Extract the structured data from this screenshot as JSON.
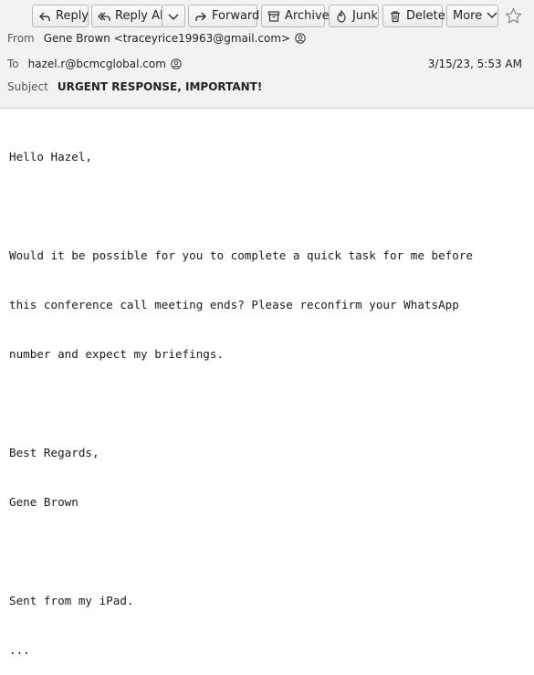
{
  "toolbar": {
    "reply_label": "Reply",
    "reply_all_label": "Reply All",
    "forward_label": "Forward",
    "archive_label": "Archive",
    "junk_label": "Junk",
    "delete_label": "Delete",
    "more_label": "More"
  },
  "header": {
    "from_label": "From",
    "from_value": "Gene Brown <traceyrice19963@gmail.com>",
    "to_label": "To",
    "to_value": "hazel.r@bcmcglobal.com",
    "date": "3/15/23, 5:53 AM",
    "subject_label": "Subject",
    "subject_value": "URGENT RESPONSE, IMPORTANT!"
  },
  "icons": {
    "reply": "reply-icon",
    "reply_all": "reply-all-icon",
    "forward": "forward-icon",
    "archive": "archive-icon",
    "junk": "junk-icon",
    "delete": "trash-icon",
    "star": "star-icon",
    "contact": "contact-icon"
  },
  "message": {
    "lines": [
      "Hello Hazel,",
      "",
      "Would it be possible for you to complete a quick task for me before",
      "this conference call meeting ends? Please reconfirm your WhatsApp",
      "number and expect my briefings.",
      "",
      "Best Regards,",
      "Gene Brown",
      "",
      "Sent from my iPad.",
      "..."
    ]
  }
}
